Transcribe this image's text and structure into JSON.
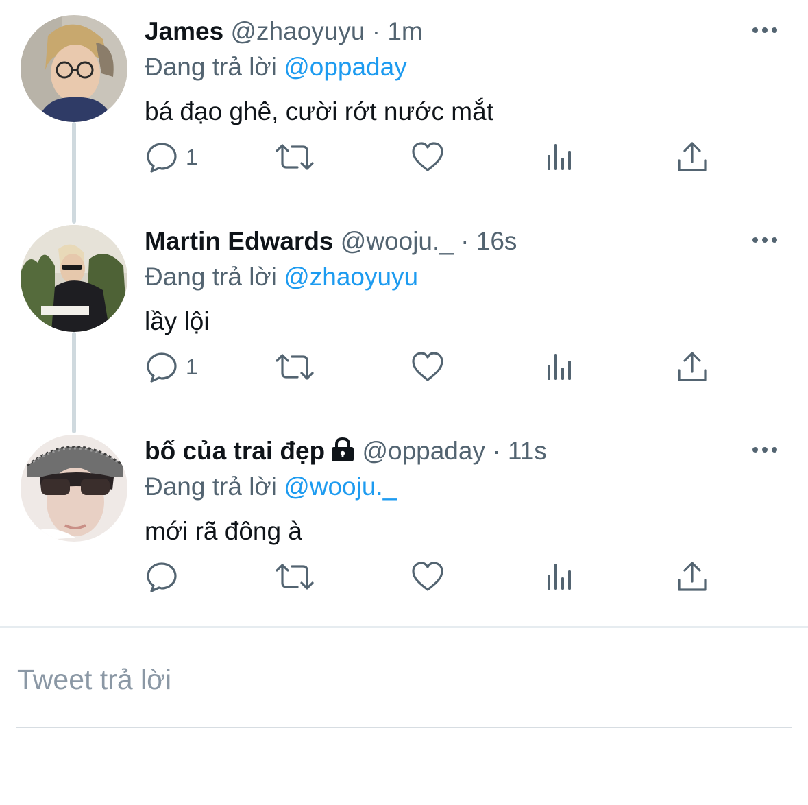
{
  "colors": {
    "link": "#1d9bf0",
    "secondary_text": "#536471",
    "thread_line": "#cfd9de"
  },
  "tweets": [
    {
      "name": "James",
      "handle": "@zhaoyuyu",
      "separator": "·",
      "time": "1m",
      "replying_label": "Đang trả lời",
      "replying_to": "@oppaday",
      "text": "bá đạo ghê, cười rớt nước mắt",
      "reply_count": "1",
      "icons": [
        "reply-icon",
        "retweet-icon",
        "like-icon",
        "analytics-icon",
        "share-icon",
        "more-icon"
      ]
    },
    {
      "name": "Martin Edwards",
      "handle": "@wooju._",
      "separator": "·",
      "time": "16s",
      "replying_label": "Đang trả lời",
      "replying_to": "@zhaoyuyu",
      "text": "lầy lội",
      "reply_count": "1",
      "icons": [
        "reply-icon",
        "retweet-icon",
        "like-icon",
        "analytics-icon",
        "share-icon",
        "more-icon"
      ]
    },
    {
      "name": "bố của trai đẹp",
      "protected": true,
      "handle": "@oppaday",
      "separator": "·",
      "time": "11s",
      "replying_label": "Đang trả lời",
      "replying_to": "@wooju._",
      "text": "mới rã đông à",
      "reply_count": "",
      "icons": [
        "lock-icon",
        "reply-icon",
        "retweet-icon",
        "like-icon",
        "analytics-icon",
        "share-icon",
        "more-icon"
      ]
    }
  ],
  "reply_box": {
    "placeholder": "Tweet trả lời"
  }
}
